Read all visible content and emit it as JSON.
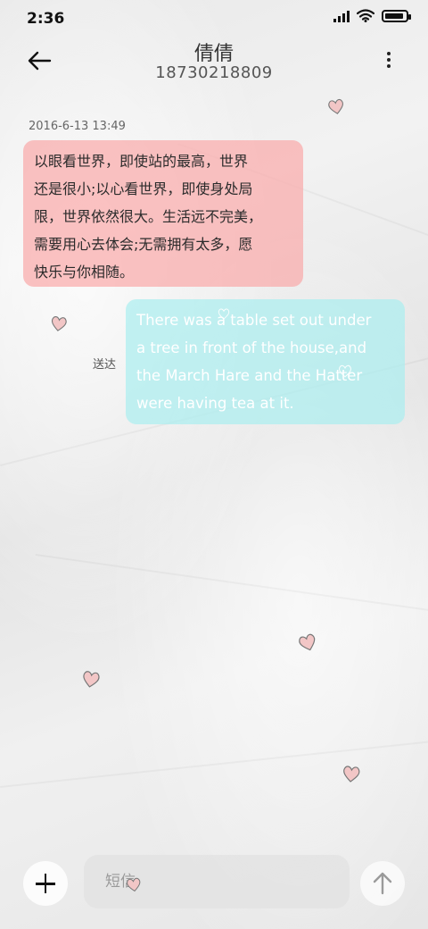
{
  "status_bar": {
    "time": "2:36",
    "icons": [
      "signal-icon",
      "wifi-icon",
      "battery-icon"
    ],
    "battery_level": 0.9
  },
  "header": {
    "title": "倩倩",
    "phone": "18730218809",
    "back_icon": "arrow-left-icon",
    "menu_icon": "more-vertical-icon"
  },
  "conversation": {
    "timestamp": "2016-6-13 13:49",
    "incoming": {
      "lines": [
        "以眼看世界，即使站的最高，世界",
        "还是很小;以心看世界，即使身处局",
        "限，世界依然很大。生活远不完美，",
        "需要用心去体会;无需拥有太多，愿",
        "快乐与你相随。"
      ],
      "color": "#f7a9aa"
    },
    "outgoing": {
      "lines": [
        "There was a table set out under",
        "a tree in front of the house,and",
        "the March Hare and the Hatter",
        "were having tea at it."
      ],
      "status": "送达",
      "color": "#aef0f1"
    }
  },
  "composer": {
    "placeholder": "短信",
    "add_icon": "plus-icon",
    "send_icon": "arrow-up-icon"
  },
  "decorations": {
    "heart_icon": "heart-icon",
    "heart_color": "#f2c6c6"
  }
}
